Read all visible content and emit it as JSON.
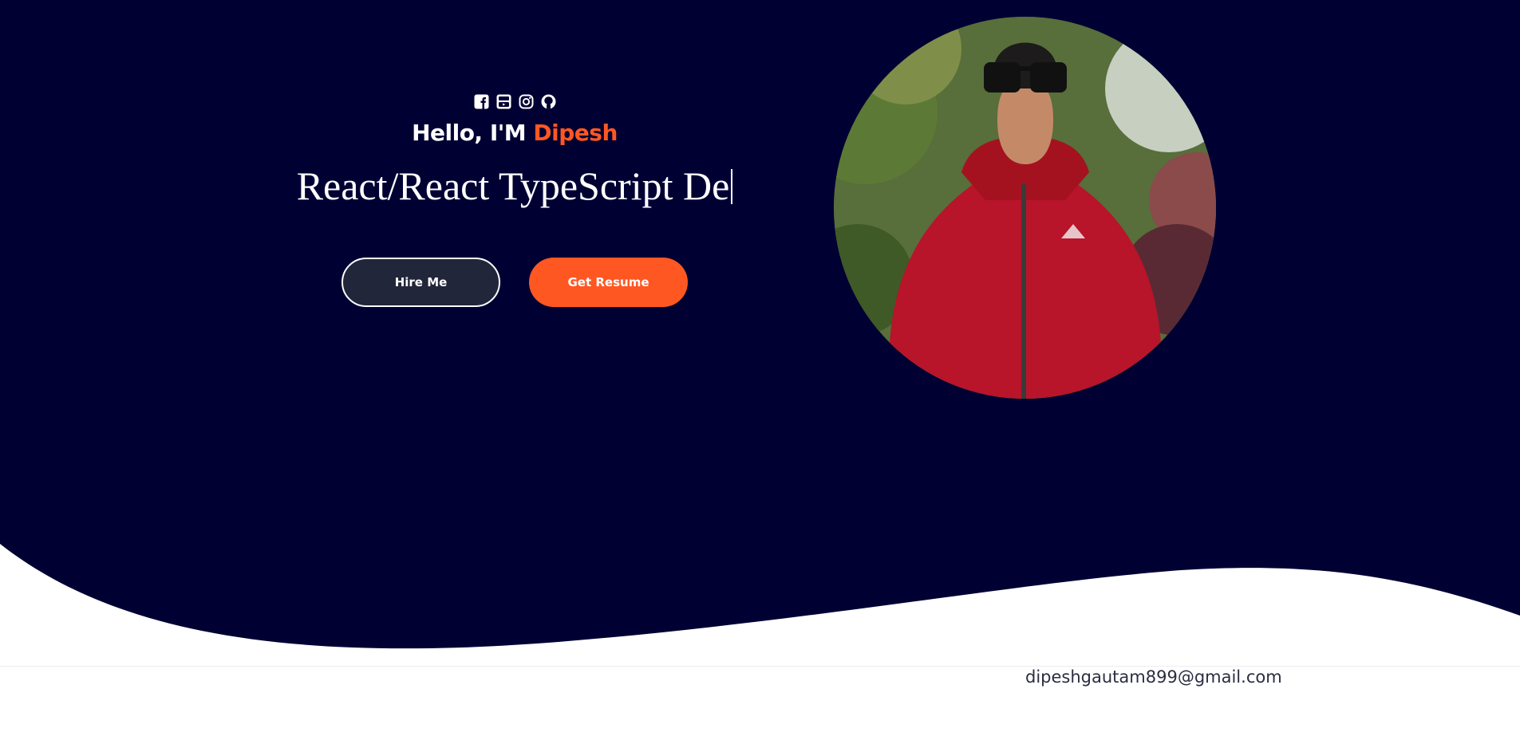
{
  "theme": {
    "hero_background": "#000033",
    "accent": "#ff5722",
    "hire_button_bg": "#22263a",
    "text": "#ffffff"
  },
  "socials": [
    {
      "icon": "facebook-icon"
    },
    {
      "icon": "youtube-icon"
    },
    {
      "icon": "instagram-icon"
    },
    {
      "icon": "github-icon"
    }
  ],
  "hero": {
    "greeting_prefix": "Hello, I'M ",
    "name": "Dipesh",
    "typed_text": "React/React TypeScript De",
    "hire_label": "Hire Me",
    "resume_label": "Get Resume"
  },
  "profile_photo": {
    "icon": "profile-photo"
  },
  "footer": {
    "email": "dipeshgautam899@gmail.com"
  }
}
